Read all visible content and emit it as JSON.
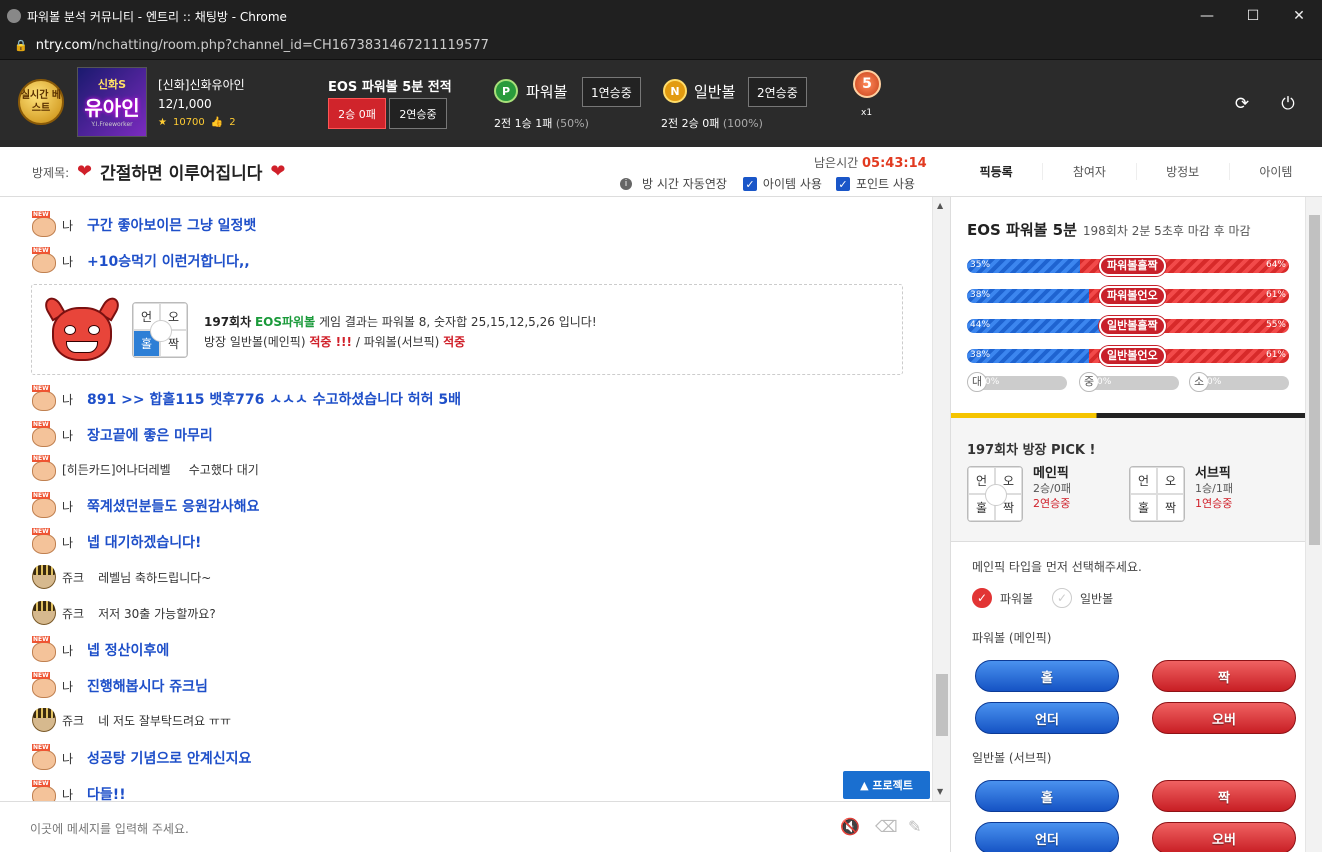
{
  "window": {
    "title": "파워볼 분석 커뮤니티 - 엔트리 :: 채팅방 - Chrome",
    "min": "—",
    "max": "☐",
    "close": "✕"
  },
  "address": {
    "domain": "ntry.com",
    "path": "/nchatting/room.php?channel_id=CH1673831467211119577"
  },
  "topbar": {
    "best_badge": "실시간 베스트",
    "avatar": {
      "line1": "신화S",
      "line2": "유아인",
      "line3": "Y.I.Freeworker"
    },
    "user_name": "[신화]신화유아인",
    "user_level": "12/1,000",
    "stars": "10700",
    "likes": "2",
    "eos_title": "EOS 파워볼 5분 전적",
    "eos_record": "2승 0패",
    "eos_streak": "2연승중",
    "powerball": {
      "coin": "P",
      "title": "파워볼",
      "streak": "1연승중",
      "record": "2전 1승 1패",
      "pct": "(50%)"
    },
    "normalball": {
      "coin": "N",
      "title": "일반볼",
      "streak": "2연승중",
      "record": "2전 2승 0패",
      "pct": "(100%)"
    },
    "medal": {
      "num": "5",
      "count": "x1"
    },
    "refresh_icon": "⟳",
    "power_icon": "⏻"
  },
  "room": {
    "label": "방제목:",
    "title": "간절하면 이루어집니다",
    "time_label": "남은시간",
    "time_value": "05:43:14",
    "auto_extend": "방 시간 자동연장",
    "item_use": "아이템 사용",
    "point_use": "포인트 사용"
  },
  "tabs": [
    "픽등록",
    "참여자",
    "방정보",
    "아이템"
  ],
  "messages": [
    {
      "type": "me",
      "name": "나",
      "text": "구간 좋아보이믄 그냥 일정뱃"
    },
    {
      "type": "me",
      "name": "나",
      "text": "+10승먹기 이런거합니다,,"
    },
    {
      "type": "me",
      "name": "나",
      "text": "891 >> 합홀115 뱃후776 ㅅㅅㅅ 수고하셨습니다 허허 5배"
    },
    {
      "type": "me",
      "name": "나",
      "text": "장고끝에 좋은 마무리"
    },
    {
      "type": "other",
      "name": "[히든카드]어나더레벨",
      "text": "수고했다 대기"
    },
    {
      "type": "me",
      "name": "나",
      "text": "쭉계셨던분들도 응원감사해요"
    },
    {
      "type": "me",
      "name": "나",
      "text": "넵 대기하겠습니다!"
    },
    {
      "type": "juke",
      "name": "쥬크",
      "text": "레벨님 축하드립니다~"
    },
    {
      "type": "juke",
      "name": "쥬크",
      "text": "저저 30출 가능할까요?"
    },
    {
      "type": "me",
      "name": "나",
      "text": "넵 정산이후에"
    },
    {
      "type": "me",
      "name": "나",
      "text": "진행해봅시다 쥬크님"
    },
    {
      "type": "juke",
      "name": "쥬크",
      "text": "네 저도 잘부탁드려요 ㅠㅠ"
    },
    {
      "type": "me",
      "name": "나",
      "text": "성공탕 기념으로 안계신지요"
    },
    {
      "type": "me",
      "name": "나",
      "text": "다들!!"
    }
  ],
  "new_badge": "NEW",
  "result": {
    "round": "197회차",
    "game": "EOS파워볼",
    "line1_rest": "게임 결과는 파워볼 8, 숫자합 25,15,12,5,26 입니다!",
    "line2_a": "방장 일반볼(메인픽)",
    "line2_b": "적중 !!!",
    "line2_c": "/ 파워볼(서브픽)",
    "line2_d": "적중",
    "grid": [
      "언",
      "오",
      "홀",
      "짝"
    ]
  },
  "input": {
    "placeholder": "이곳에 메세지를 입력해 주세요."
  },
  "project_btn": "▲ 프로젝트",
  "side": {
    "title": "EOS 파워볼 5분",
    "subtitle": "198회차 2분 5초후 마감 후 마감",
    "bars": [
      {
        "left": "35%",
        "right": "64%",
        "label": "파워볼홀짝",
        "lv": 0.35
      },
      {
        "left": "38%",
        "right": "61%",
        "label": "파워볼언오",
        "lv": 0.38
      },
      {
        "left": "44%",
        "right": "55%",
        "label": "일반볼홀짝",
        "lv": 0.44
      },
      {
        "left": "38%",
        "right": "61%",
        "label": "일반볼언오",
        "lv": 0.38
      }
    ],
    "minis": [
      {
        "c": "대",
        "v": "0%"
      },
      {
        "c": "중",
        "v": "0%"
      },
      {
        "c": "소",
        "v": "0%"
      }
    ],
    "pick_title": "197회차 방장 PICK !",
    "main": {
      "label": "메인픽",
      "record": "2승/0패",
      "streak": "2연승중"
    },
    "sub": {
      "label": "서브픽",
      "record": "1승/1패",
      "streak": "1연승중"
    },
    "prompt": "메인픽 타입을 먼저 선택해주세요.",
    "radio_power": "파워볼",
    "radio_normal": "일반볼",
    "sec_main": "파워볼 (메인픽)",
    "sec_sub": "일반볼 (서브픽)",
    "btn_hol": "홀",
    "btn_jjak": "짝",
    "btn_under": "언더",
    "btn_over": "오버"
  }
}
